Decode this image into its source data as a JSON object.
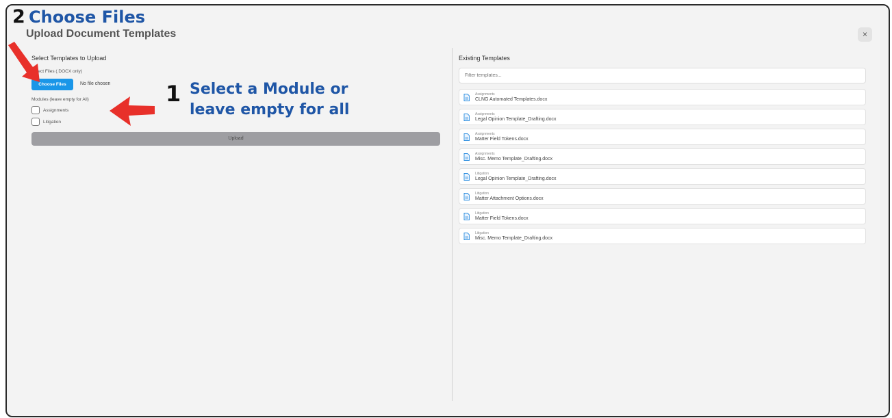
{
  "annotations": {
    "step2_number": "2",
    "step2_text": "Choose Files",
    "step1_number": "1",
    "step1_line1": "Select a Module or",
    "step1_line2": "leave empty for all"
  },
  "dialog": {
    "title": "Upload Document Templates",
    "close_label": "×"
  },
  "upload": {
    "section_title": "Select Templates to Upload",
    "files_label": "Select Files (.DOCX only)",
    "choose_button": "Choose Files",
    "no_file_text": "No file chosen",
    "modules_label": "Modules (leave empty for All)",
    "modules": [
      "Assignments",
      "Litigation"
    ],
    "upload_button": "Upload"
  },
  "existing": {
    "section_title": "Existing Templates",
    "filter_placeholder": "Filter templates...",
    "templates": [
      {
        "module": "Assignments",
        "name": "CLNG Automated Templates.docx"
      },
      {
        "module": "Assignments",
        "name": "Legal Opinion Template_Drafting.docx"
      },
      {
        "module": "Assignments",
        "name": "Matter Field Tokens.docx"
      },
      {
        "module": "Assignments",
        "name": "Misc. Memo Template_Drafting.docx"
      },
      {
        "module": "Litigation",
        "name": "Legal Opinion Template_Drafting.docx"
      },
      {
        "module": "Litigation",
        "name": "Matter Attachment Options.docx"
      },
      {
        "module": "Litigation",
        "name": "Matter Field Tokens.docx"
      },
      {
        "module": "Litigation",
        "name": "Misc. Memo Template_Drafting.docx"
      }
    ]
  },
  "colors": {
    "accent_blue": "#1a96e8",
    "annotation_blue": "#1f56a6",
    "arrow_red": "#e8302a"
  }
}
